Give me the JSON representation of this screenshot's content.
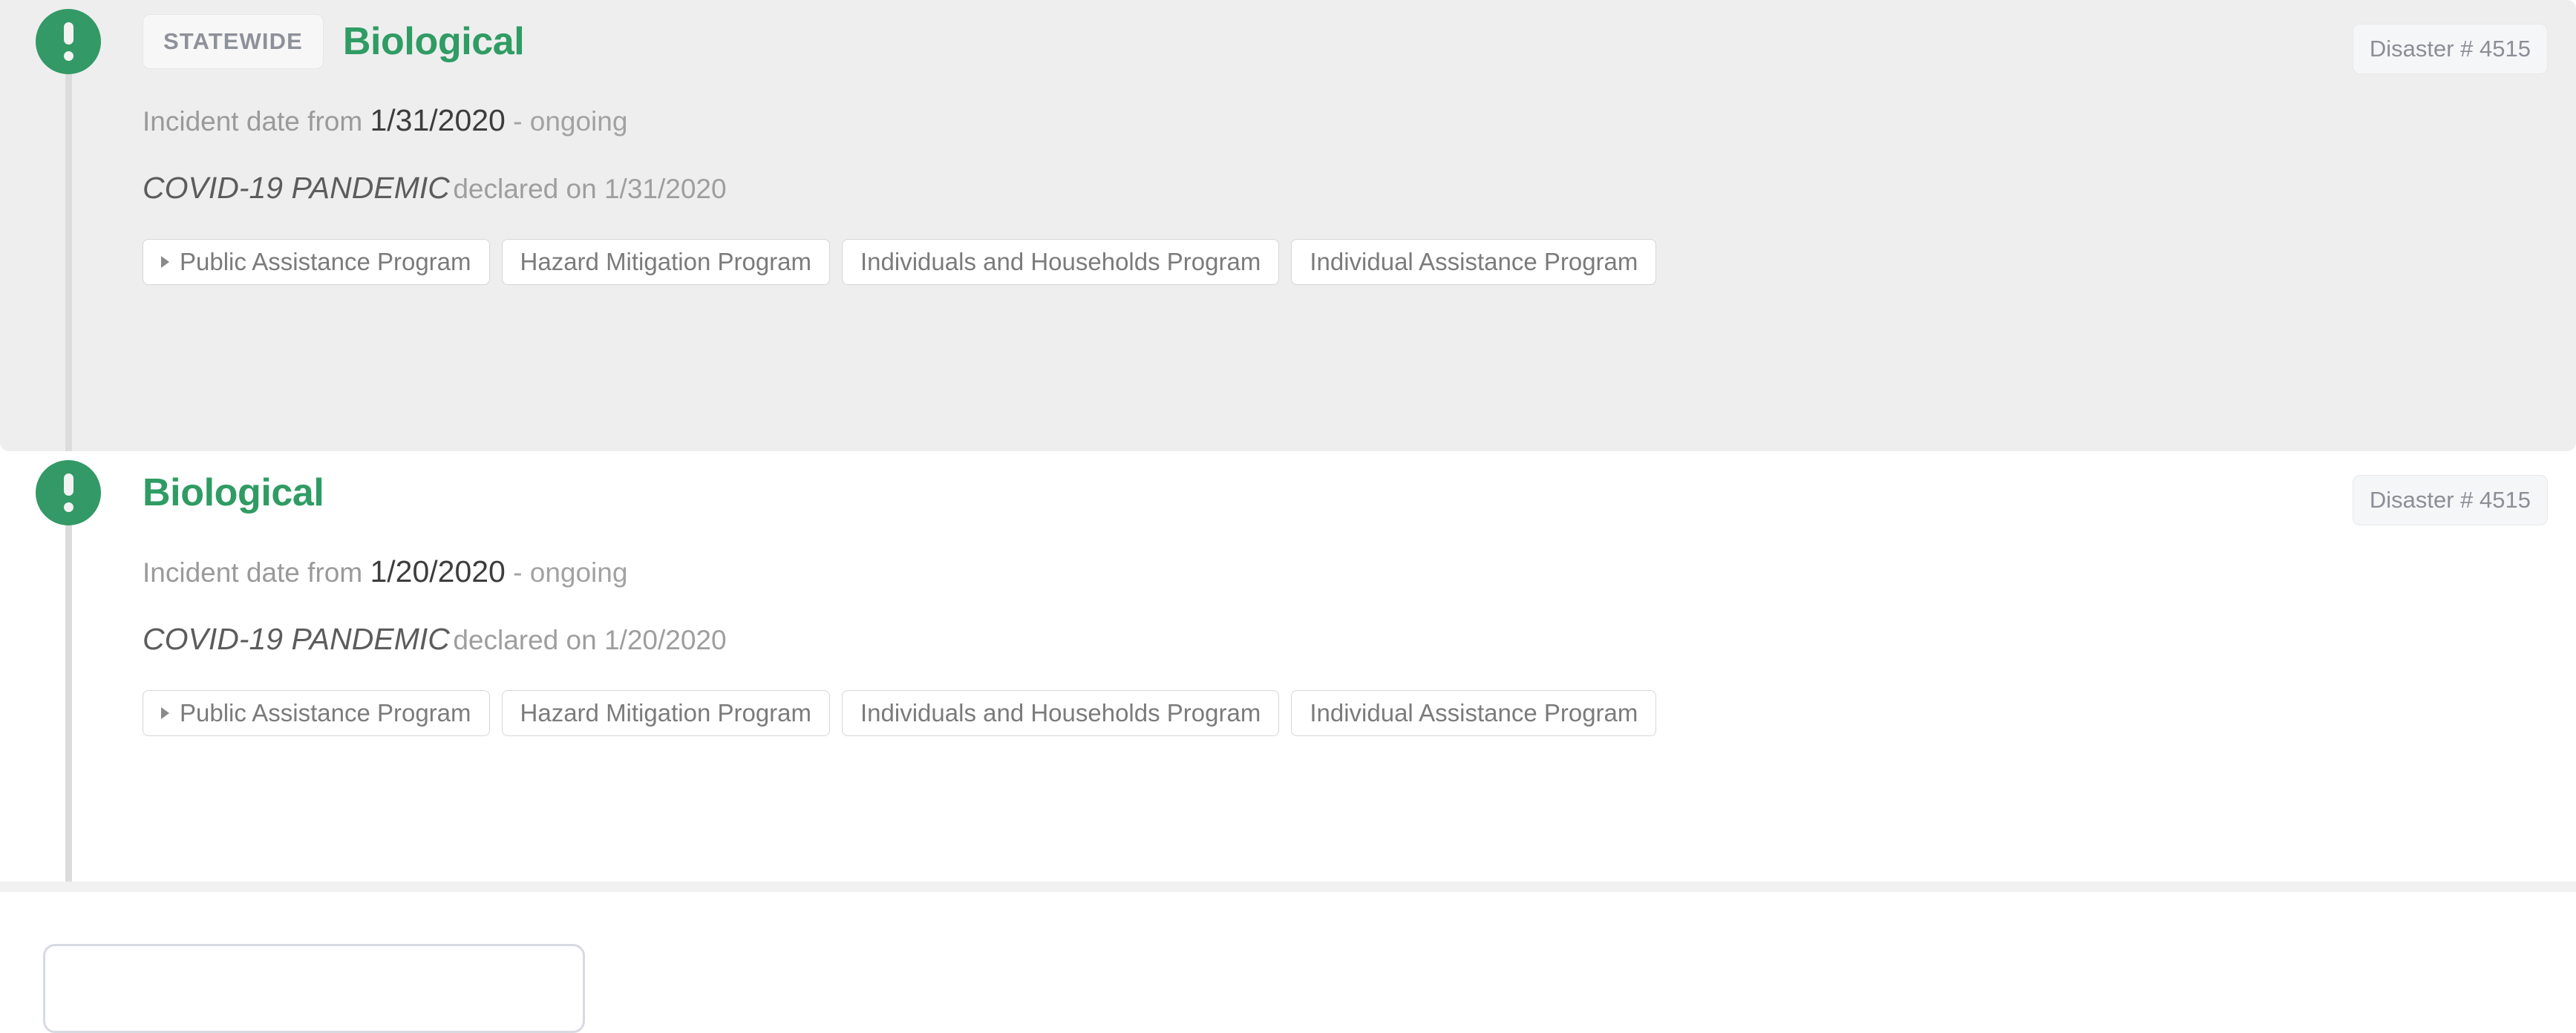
{
  "theme": {
    "accent_green": "#339966",
    "type_green": "#2f9c63",
    "shaded_card_bg": "#eeeeee",
    "badge_bg": "#f5f6f7",
    "badge_text": "#8b8e96",
    "timeline_line": "#dcdcdc",
    "divider": "#f1f1f1"
  },
  "disasters": [
    {
      "scope_badge": "STATEWIDE",
      "type": "Biological",
      "number_badge": "Disaster # 4515",
      "incident_prefix": "Incident date from",
      "incident_date": "1/31/2020",
      "incident_suffix": "- ongoing",
      "declaration_title": "COVID-19 PANDEMIC",
      "declaration_rest": "declared on 1/31/2020",
      "marker_icon": "exclamation-circle-icon",
      "programs": [
        {
          "label": "Public Assistance Program",
          "expandable": true
        },
        {
          "label": "Hazard Mitigation Program",
          "expandable": false
        },
        {
          "label": "Individuals and Households Program",
          "expandable": false
        },
        {
          "label": "Individual Assistance Program",
          "expandable": false
        }
      ]
    },
    {
      "scope_badge": "",
      "type": "Biological",
      "number_badge": "Disaster # 4515",
      "incident_prefix": "Incident date from",
      "incident_date": "1/20/2020",
      "incident_suffix": "- ongoing",
      "declaration_title": "COVID-19 PANDEMIC",
      "declaration_rest": "declared on 1/20/2020",
      "marker_icon": "exclamation-circle-icon",
      "programs": [
        {
          "label": "Public Assistance Program",
          "expandable": true
        },
        {
          "label": "Hazard Mitigation Program",
          "expandable": false
        },
        {
          "label": "Individuals and Households Program",
          "expandable": false
        },
        {
          "label": "Individual Assistance Program",
          "expandable": false
        }
      ]
    }
  ]
}
